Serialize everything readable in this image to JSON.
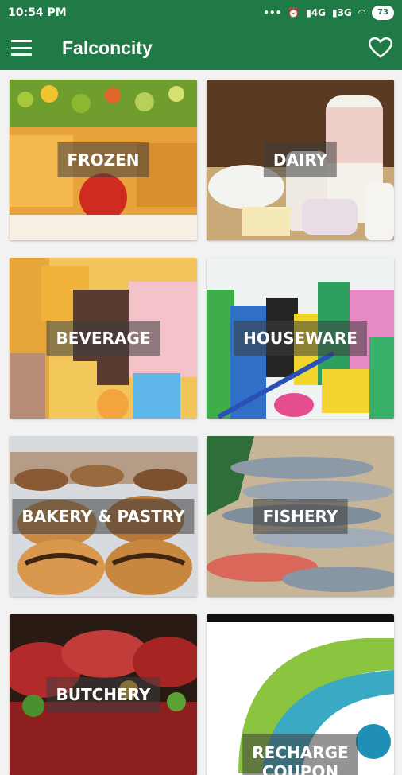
{
  "status_bar": {
    "time": "10:54 PM",
    "dots": "•••",
    "signal_1": "4G",
    "signal_2": "3G",
    "battery": "73"
  },
  "app_bar": {
    "title": "Falconcity",
    "menu_icon": "hamburger-menu-icon",
    "favorite_icon": "heart-outline-icon"
  },
  "colors": {
    "primary": "#1f7a45",
    "label_overlay": "rgba(60,60,60,0.55)"
  },
  "categories": [
    {
      "label": "FROZEN"
    },
    {
      "label": "DAIRY"
    },
    {
      "label": "BEVERAGE"
    },
    {
      "label": "HOUSEWARE"
    },
    {
      "label": "BAKERY & PASTRY"
    },
    {
      "label": "FISHERY"
    },
    {
      "label": "BUTCHERY"
    },
    {
      "label": "RECHARGE COUPON"
    }
  ]
}
